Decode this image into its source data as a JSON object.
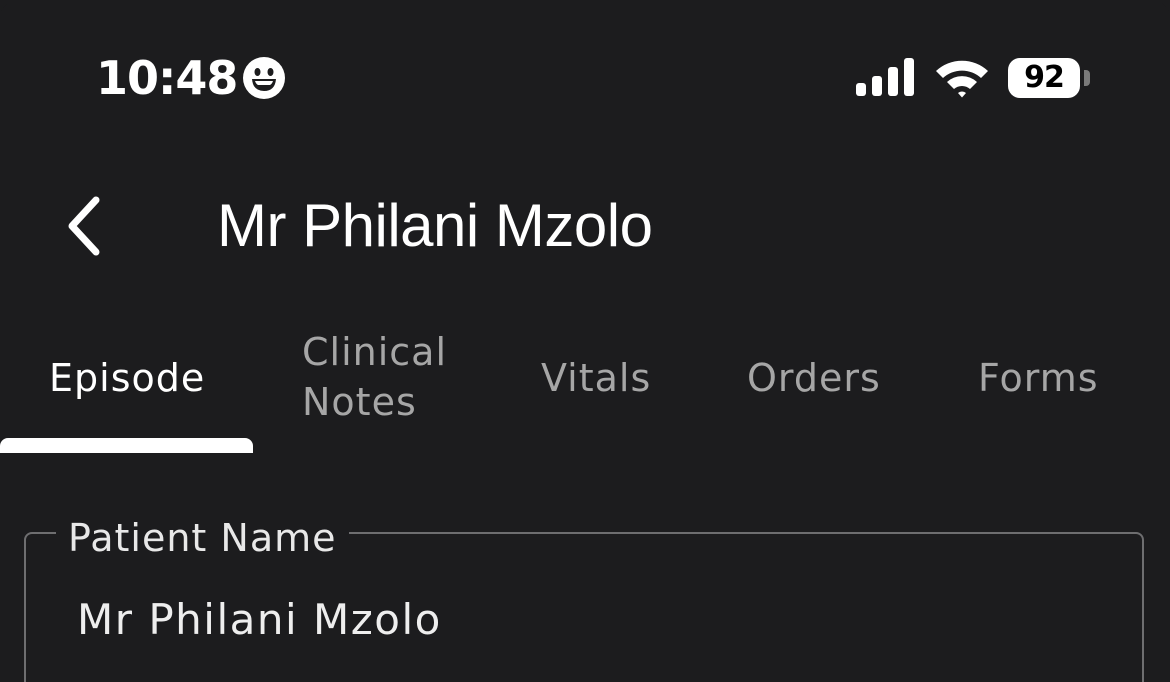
{
  "status_bar": {
    "time": "10:48",
    "status_icon": "smiley-face-icon",
    "signal_icon": "cellular-signal-icon",
    "wifi_icon": "wifi-icon",
    "battery_level": "92"
  },
  "header": {
    "back_icon": "chevron-left-icon",
    "title": "Mr Philani Mzolo"
  },
  "tabs": [
    {
      "label": "Episode",
      "active": true
    },
    {
      "label": "Clinical\nNotes",
      "active": false
    },
    {
      "label": "Vitals",
      "active": false
    },
    {
      "label": "Orders",
      "active": false
    },
    {
      "label": "Forms",
      "active": false
    }
  ],
  "form": {
    "patient_name": {
      "label": "Patient Name",
      "value": "Mr Philani Mzolo"
    }
  },
  "colors": {
    "background": "#1c1c1e",
    "text_primary": "#ffffff",
    "text_inactive": "#a6a6a6",
    "field_border": "#6e6e70"
  }
}
